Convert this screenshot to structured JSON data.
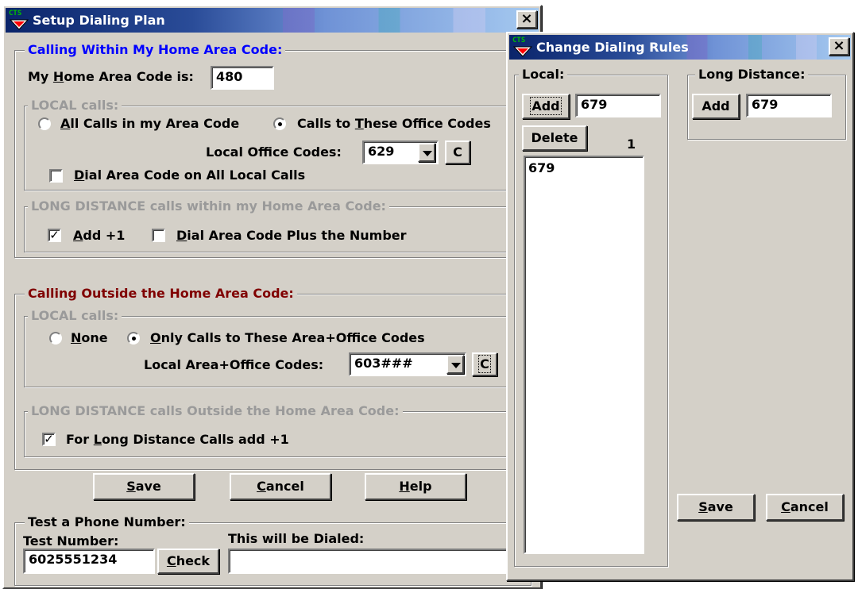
{
  "setup": {
    "title": "Setup Dialing Plan",
    "logo_text": "CTS",
    "close_symbol": "×",
    "home": {
      "legend": "Calling Within My Home Area Code:",
      "area_label_pre": "My ",
      "area_label_key": "H",
      "area_label_post": "ome Area Code is:",
      "area_value": "480",
      "local": {
        "legend": "LOCAL calls:",
        "opt_all_key": "A",
        "opt_all_rest": "ll Calls in my Area Code",
        "opt_these_pre": "Calls to ",
        "opt_these_key": "T",
        "opt_these_post": "hese Office Codes",
        "selected": "these",
        "codes_label": "Local Office Codes:",
        "codes_value": "629",
        "c_button": "C",
        "dial_area_key": "D",
        "dial_area_rest": "ial Area Code on All Local Calls",
        "dial_area_checked": false
      },
      "ld": {
        "legend": "LONG DISTANCE calls within my Home Area Code:",
        "add1_key": "A",
        "add1_rest": "dd +1",
        "add1_checked": true,
        "dialarea_key": "D",
        "dialarea_rest": "ial Area Code Plus the Number",
        "dialarea_checked": false
      }
    },
    "outside": {
      "legend": "Calling Outside the Home Area Code:",
      "local": {
        "legend": "LOCAL calls:",
        "none_key": "N",
        "none_rest": "one",
        "only_key": "O",
        "only_rest": "nly Calls to These Area+Office Codes",
        "selected": "only",
        "codes_label": "Local Area+Office Codes:",
        "codes_value": "603###",
        "c_button": "C"
      },
      "ld": {
        "legend": "LONG DISTANCE calls Outside the Home Area Code:",
        "add1_pre": "For ",
        "add1_key": "L",
        "add1_post": "ong Distance Calls add +1",
        "add1_checked": true
      }
    },
    "buttons": {
      "save_key": "S",
      "save_rest": "ave",
      "cancel_key": "C",
      "cancel_rest": "ancel",
      "help_key": "H",
      "help_rest": "elp"
    },
    "test": {
      "legend": "Test a Phone Number:",
      "number_label": "Test Number:",
      "number_value": "6025551234",
      "check_key": "C",
      "check_rest": "heck",
      "dialed_label": "This will be Dialed:",
      "dialed_value": ""
    }
  },
  "rules": {
    "title": "Change Dialing Rules",
    "logo_text": "CTS",
    "close_symbol": "×",
    "local": {
      "legend": "Local:",
      "add_label": "Add",
      "add_value": "679",
      "delete_label": "Delete",
      "count": "1",
      "list": [
        "679"
      ]
    },
    "ld": {
      "legend": "Long Distance:",
      "add_label": "Add",
      "add_value": "679"
    },
    "buttons": {
      "save_key": "S",
      "save_rest": "ave",
      "cancel_key": "C",
      "cancel_rest": "ancel"
    }
  },
  "colors": {
    "home_legend": "#0000ff",
    "outside_legend": "#800000",
    "disabled_text": "#9a9a9a",
    "logo_green": "#00c000"
  }
}
